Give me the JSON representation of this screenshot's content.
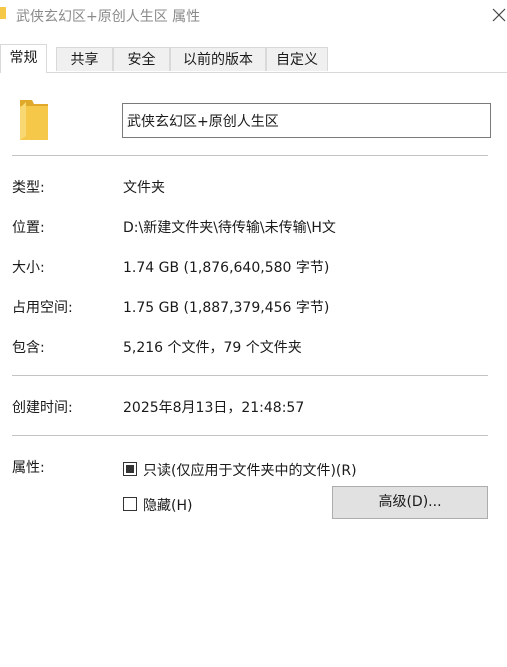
{
  "window": {
    "title": "武侠玄幻区+原创人生区 属性"
  },
  "tabs": [
    {
      "label": "常规",
      "active": true
    },
    {
      "label": "共享",
      "active": false
    },
    {
      "label": "安全",
      "active": false
    },
    {
      "label": "以前的版本",
      "active": false
    },
    {
      "label": "自定义",
      "active": false
    }
  ],
  "general": {
    "name": "武侠玄幻区+原创人生区",
    "type_label": "类型:",
    "type_value": "文件夹",
    "location_label": "位置:",
    "location_value": "D:\\新建文件夹\\待传输\\未传输\\H文",
    "size_label": "大小:",
    "size_value": "1.74 GB (1,876,640,580 字节)",
    "disk_size_label": "占用空间:",
    "disk_size_value": "1.75 GB (1,887,379,456 字节)",
    "contains_label": "包含:",
    "contains_value": "5,216 个文件，79 个文件夹",
    "created_label": "创建时间:",
    "created_value": "2025年8月13日，21:48:57",
    "attributes_label": "属性:",
    "readonly_label": "只读(仅应用于文件夹中的文件)(R)",
    "hidden_label": "隐藏(H)",
    "advanced_label": "高级(D)..."
  },
  "colors": {
    "folder": "#f5c84a",
    "folder_dark": "#e0a92a",
    "accent": "#ffffff"
  },
  "icons": {
    "title": "folder-icon",
    "close": "close-icon",
    "folder": "folder-icon"
  }
}
